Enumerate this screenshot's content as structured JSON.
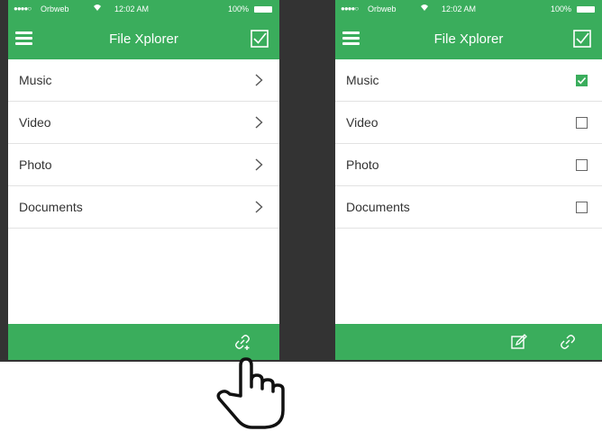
{
  "status_bar": {
    "signal": "●●●●○",
    "carrier": "Orbweb",
    "wifi_icon": "wifi-icon",
    "time": "12:02 AM",
    "battery": "100%"
  },
  "app": {
    "title": "File Xplorer",
    "accent_color": "#3aad5c"
  },
  "left_screen": {
    "items": [
      {
        "label": "Music"
      },
      {
        "label": "Video"
      },
      {
        "label": "Photo"
      },
      {
        "label": "Documents"
      }
    ],
    "bottom_icons": [
      "link-icon"
    ]
  },
  "right_screen": {
    "items": [
      {
        "label": "Music",
        "checked": true
      },
      {
        "label": "Video",
        "checked": false
      },
      {
        "label": "Photo",
        "checked": false
      },
      {
        "label": "Documents",
        "checked": false
      }
    ],
    "bottom_icons": [
      "edit-icon",
      "link-icon"
    ]
  },
  "overlay": {
    "icon": "pointing-hand-icon"
  }
}
